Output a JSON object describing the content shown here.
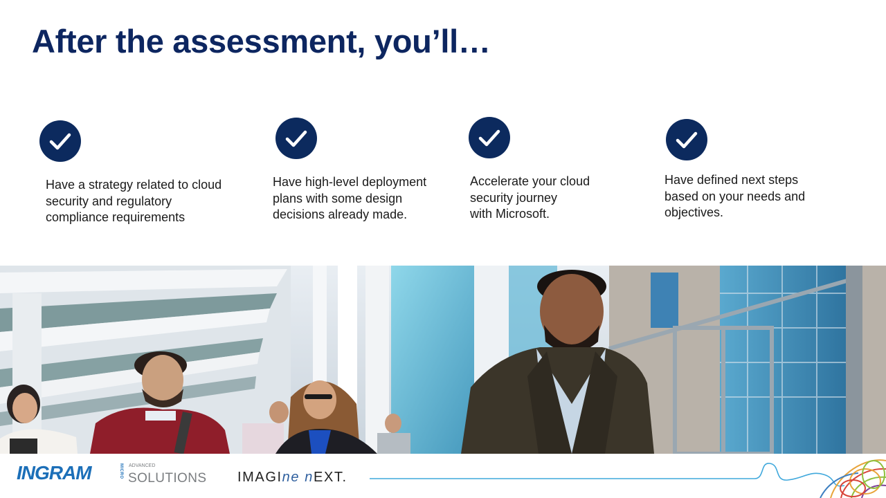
{
  "slide": {
    "title": "After the assessment, you’ll…",
    "title_color": "#0d2660",
    "outcomes": [
      {
        "text": "Have a strategy related to cloud\nsecurity and regulatory\ncompliance requirements",
        "icon": "checkmark-icon"
      },
      {
        "text": "Have high-level deployment\nplans with some design\ndecisions already made.",
        "icon": "checkmark-icon"
      },
      {
        "text": "Accelerate your cloud\nsecurity journey\nwith Microsoft.",
        "icon": "checkmark-icon"
      },
      {
        "text": "Have defined next steps\nbased on your needs and\nobjectives.",
        "icon": "checkmark-icon"
      }
    ],
    "check_color": "#0c2a5e"
  },
  "footer": {
    "brand_name": "INGRAM",
    "brand_micro": "MICRO",
    "brand_advanced": "ADVANCED",
    "brand_solutions": "SOLUTIONS",
    "brand_color": "#1c6fb8",
    "tagline_prefix": "IMAGI",
    "tagline_accent1": "ne",
    "tagline_mid": " ",
    "tagline_accent2": "n",
    "tagline_suffix": "EXT.",
    "accent_color": "#2e5f9e",
    "line_color": "#3fa8dc"
  }
}
